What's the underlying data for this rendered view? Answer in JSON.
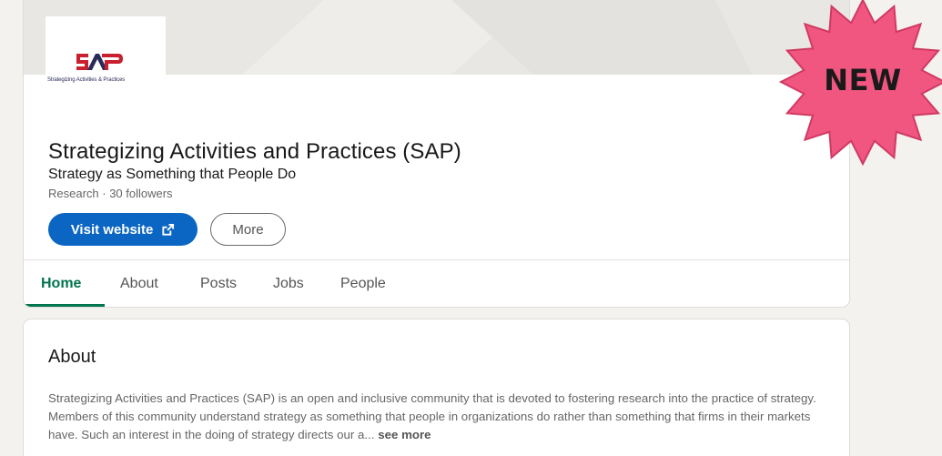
{
  "company": {
    "name": "Strategizing Activities and Practices (SAP)",
    "tagline": "Strategy as Something that People Do",
    "meta": "Research · 30 followers",
    "logo_text": "SAP",
    "logo_subtext": "Strategizing Activities & Practices"
  },
  "actions": {
    "visit_label": "Visit website",
    "more_label": "More"
  },
  "tabs": [
    {
      "label": "Home",
      "active": true
    },
    {
      "label": "About",
      "active": false
    },
    {
      "label": "Posts",
      "active": false
    },
    {
      "label": "Jobs",
      "active": false
    },
    {
      "label": "People",
      "active": false
    }
  ],
  "about": {
    "title": "About",
    "text": "Strategizing Activities and Practices (SAP) is an open and inclusive community that is devoted to fostering research into the practice of strategy. Members of this community understand strategy as something that people in organizations do rather than something that firms in their markets have. Such an interest in the doing of strategy directs our a...",
    "see_more": "see more"
  },
  "badge": {
    "label": "NEW",
    "color": "#f0567f"
  },
  "colors": {
    "primary": "#0a66c2",
    "active_tab": "#01754f",
    "logo_red": "#c8202f",
    "logo_navy": "#2a2a5a"
  },
  "icons": {
    "visit": "external-link-icon",
    "badge": "starburst-icon"
  }
}
